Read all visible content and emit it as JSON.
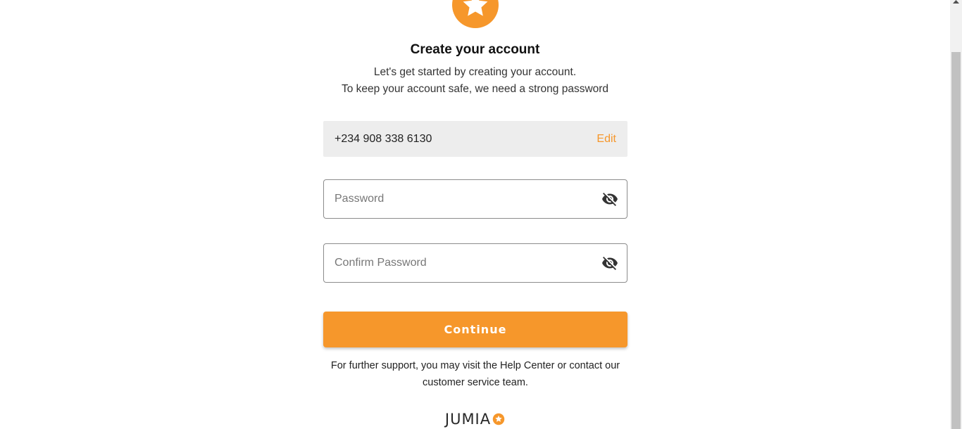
{
  "header": {
    "logo_icon": "star-icon",
    "title": "Create your account",
    "subtitle_line1": "Let's get started by creating your account.",
    "subtitle_line2": "To keep your account safe, we need a strong password"
  },
  "phone": {
    "value": "+234 908 338 6130",
    "edit_label": "Edit"
  },
  "password": {
    "placeholder": "Password",
    "value": "",
    "toggle_icon": "eye-off-icon"
  },
  "confirm_password": {
    "placeholder": "Confirm Password",
    "value": "",
    "toggle_icon": "eye-off-icon"
  },
  "continue_label": "Continue",
  "support_text": "For further support, you may visit the Help Center or contact our customer service team.",
  "footer": {
    "brand": "JUMIA",
    "brand_icon": "star-icon"
  },
  "colors": {
    "accent": "#f6972b",
    "phone_bg": "#ededed",
    "text": "#282828"
  }
}
